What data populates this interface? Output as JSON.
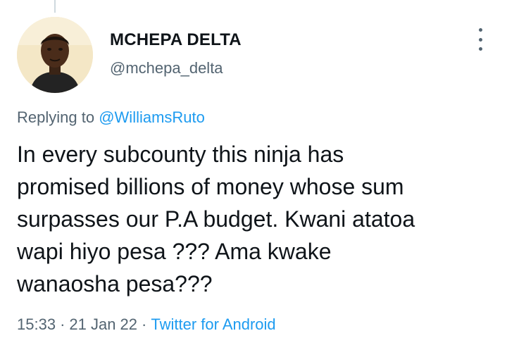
{
  "tweet": {
    "author": {
      "display_name": "MCHEPA DELTA",
      "handle": "@mchepa_delta"
    },
    "replying_to": {
      "prefix": "Replying to",
      "mention": "@WilliamsRuto"
    },
    "text": "In every subcounty this ninja has\npromised billions of money whose sum\nsurpasses our P.A budget.  Kwani atatoa\nwapi hiyo pesa ??? Ama kwake\nwanaosha pesa???",
    "time": "15:33",
    "separator": "·",
    "date": "21 Jan 22",
    "source": "Twitter for Android"
  },
  "icons": {
    "more": "more-vertical-icon"
  },
  "colors": {
    "text": "#0f1419",
    "secondary": "#536471",
    "link": "#1d9bf0",
    "thread_line": "#cfd9de"
  }
}
